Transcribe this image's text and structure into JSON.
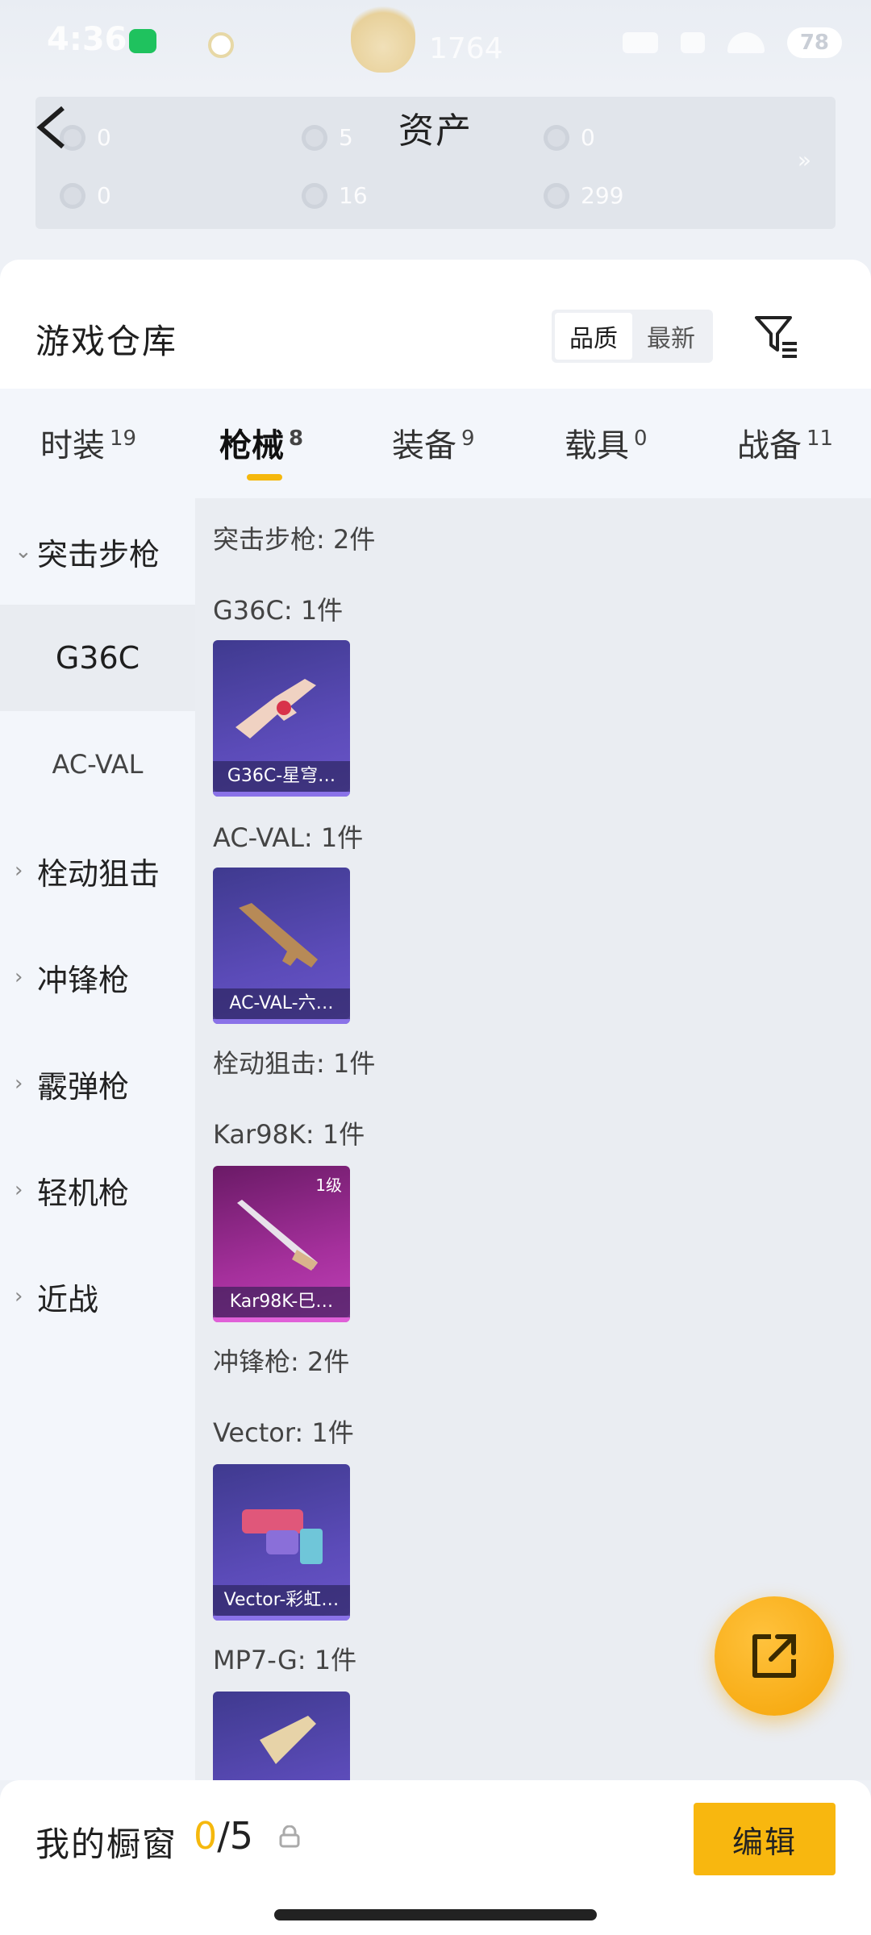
{
  "status_bar": {
    "time": "4:36",
    "score": "1764",
    "battery": "78"
  },
  "header": {
    "title": "资产"
  },
  "assets": [
    {
      "value": "0"
    },
    {
      "value": "5"
    },
    {
      "value": "0"
    },
    {
      "value": "0"
    },
    {
      "value": "16"
    },
    {
      "value": "299"
    }
  ],
  "assets_more": "»",
  "warehouse": {
    "title": "游戏仓库",
    "sort_options": [
      "品质",
      "最新"
    ],
    "sort_selected": "品质"
  },
  "tabs": [
    {
      "label": "时装",
      "count": "19"
    },
    {
      "label": "枪械",
      "count": "8"
    },
    {
      "label": "装备",
      "count": "9"
    },
    {
      "label": "载具",
      "count": "0"
    },
    {
      "label": "战备",
      "count": "11"
    }
  ],
  "sidebar": {
    "expanded_category": "突击步枪",
    "sub_items": [
      "G36C",
      "AC-VAL"
    ],
    "categories": [
      "栓动狙击",
      "冲锋枪",
      "霰弹枪",
      "轻机枪",
      "近战"
    ]
  },
  "content": {
    "sections": [
      {
        "title": "突击步枪: 2件"
      },
      {
        "title": "G36C: 1件"
      },
      {
        "title": "AC-VAL: 1件"
      },
      {
        "title": "栓动狙击: 1件"
      },
      {
        "title": "Kar98K: 1件"
      },
      {
        "title": "冲锋枪: 2件"
      },
      {
        "title": "Vector: 1件"
      },
      {
        "title": "MP7-G: 1件"
      }
    ],
    "items": [
      {
        "name": "G36C-星穹…",
        "level": ""
      },
      {
        "name": "AC-VAL-六…",
        "level": ""
      },
      {
        "name": "Kar98K-巳…",
        "level": "1级"
      },
      {
        "name": "Vector-彩虹…",
        "level": ""
      },
      {
        "name": "",
        "level": ""
      }
    ]
  },
  "bottom_bar": {
    "label": "我的橱窗",
    "current": "0",
    "separator": "/",
    "max": "5",
    "edit_label": "编辑"
  },
  "colors": {
    "accent": "#f5b80d",
    "item_purple": "#5b4bb8",
    "item_pink": "#a5309c"
  }
}
